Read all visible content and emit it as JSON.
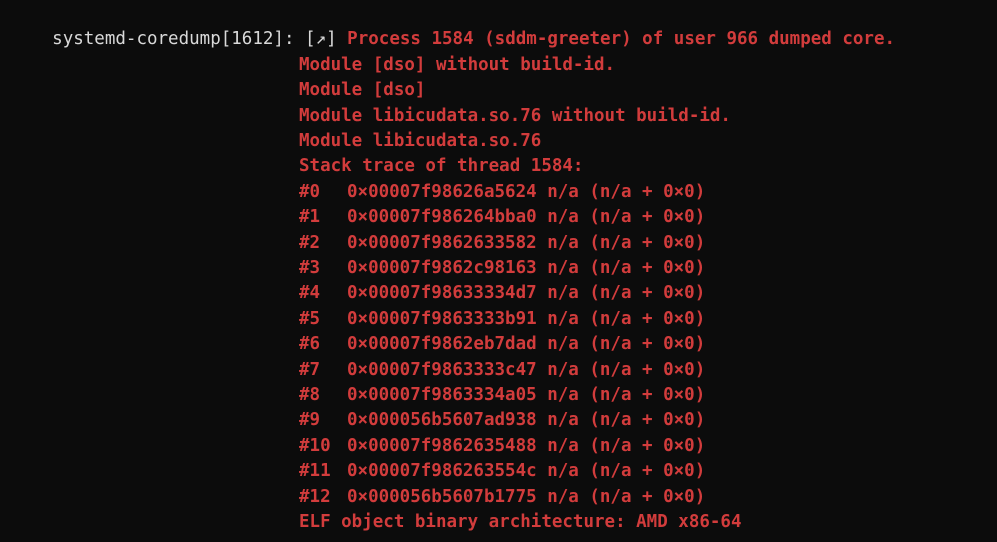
{
  "terminal": {
    "prefix": "systemd-coredump[1612]: ",
    "marker": "[↗]",
    "header_message": " Process 1584 (sddm-greeter) of user 966 dumped core.",
    "modules": [
      "Module [dso] without build-id.",
      "Module [dso]",
      "Module libicudata.so.76 without build-id.",
      "Module libicudata.so.76"
    ],
    "stack_title": "Stack trace of thread 1584:",
    "frames": [
      {
        "num": "#0",
        "addr": "0×00007f98626a5624",
        "info": "n/a (n/a + 0×0)"
      },
      {
        "num": "#1",
        "addr": "0×00007f986264bba0",
        "info": "n/a (n/a + 0×0)"
      },
      {
        "num": "#2",
        "addr": "0×00007f9862633582",
        "info": "n/a (n/a + 0×0)"
      },
      {
        "num": "#3",
        "addr": "0×00007f9862c98163",
        "info": "n/a (n/a + 0×0)"
      },
      {
        "num": "#4",
        "addr": "0×00007f98633334d7",
        "info": "n/a (n/a + 0×0)"
      },
      {
        "num": "#5",
        "addr": "0×00007f9863333b91",
        "info": "n/a (n/a + 0×0)"
      },
      {
        "num": "#6",
        "addr": "0×00007f9862eb7dad",
        "info": "n/a (n/a + 0×0)"
      },
      {
        "num": "#7",
        "addr": "0×00007f9863333c47",
        "info": "n/a (n/a + 0×0)"
      },
      {
        "num": "#8",
        "addr": "0×00007f9863334a05",
        "info": "n/a (n/a + 0×0)"
      },
      {
        "num": "#9",
        "addr": "0×000056b5607ad938",
        "info": "n/a (n/a + 0×0)"
      },
      {
        "num": "#10",
        "addr": "0×00007f9862635488",
        "info": "n/a (n/a + 0×0)"
      },
      {
        "num": "#11",
        "addr": "0×00007f986263554c",
        "info": "n/a (n/a + 0×0)"
      },
      {
        "num": "#12",
        "addr": "0×000056b5607b1775",
        "info": "n/a (n/a + 0×0)"
      }
    ],
    "elf_line": "ELF object binary architecture: AMD x86-64"
  },
  "colors": {
    "background": "#0c0c0c",
    "text": "#d9d9d9",
    "error": "#d23c3c"
  }
}
